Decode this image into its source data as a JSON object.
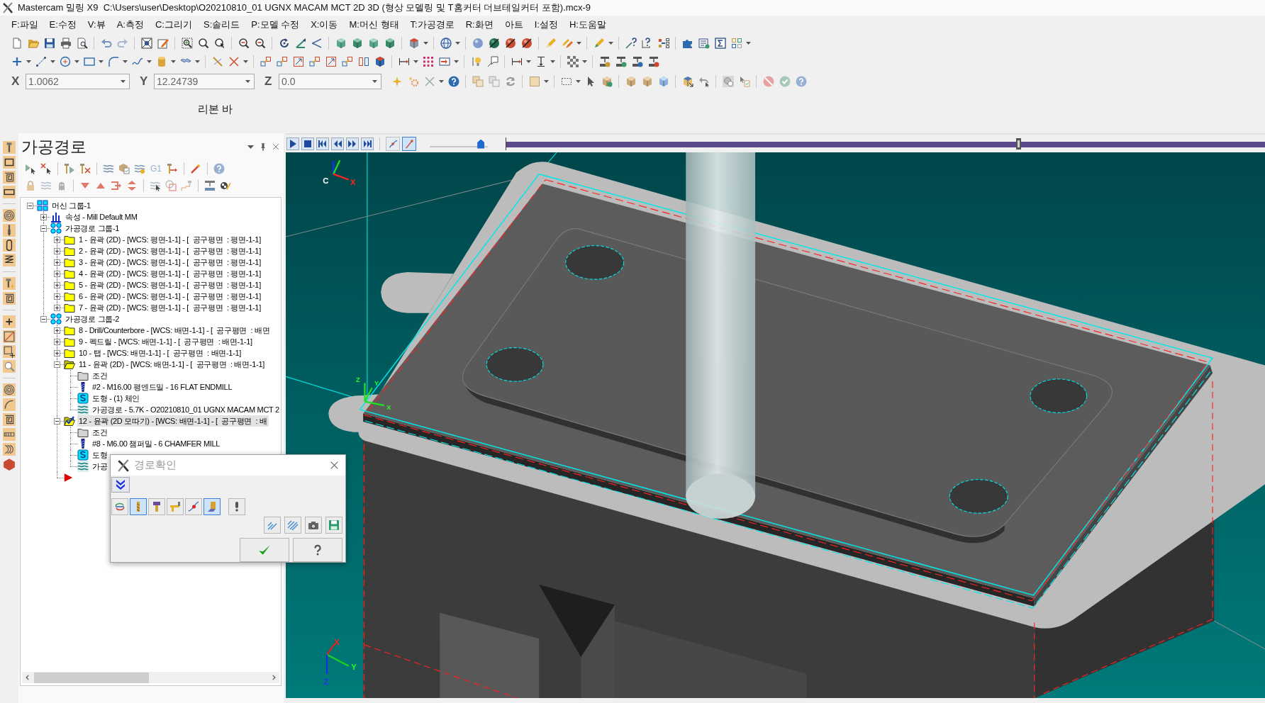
{
  "window": {
    "title": "Mastercam 밀링 X9  C:\\Users\\user\\Desktop\\O20210810_01 UGNX MACAM MCT 2D 3D (형상 모델링 및 T홈커터 더브테일커터 포함).mcx-9"
  },
  "menu": [
    "F:파일",
    "E:수정",
    "V:뷰",
    "A:측정",
    "C:그리기",
    "S:솔리드",
    "P:모델 수정",
    "X:이동",
    "M:머신 형태",
    "T:가공경로",
    "R:화면",
    "아트",
    "I:설정",
    "H:도움말"
  ],
  "coordinate_bar": [
    {
      "axis": "X",
      "value": "1.0062"
    },
    {
      "axis": "Y",
      "value": "12.24739"
    },
    {
      "axis": "Z",
      "value": "0.0"
    }
  ],
  "ribbon_bar": {
    "label": "리본 바"
  },
  "toolpaths_panel": {
    "title": "가공경로",
    "toolbar_text": "G1",
    "tree": [
      {
        "label": "머신 그룹-1",
        "kind": "machine_group",
        "expanded": true,
        "selected": false,
        "children": [
          {
            "label": "속성 - Mill Default MM",
            "kind": "properties",
            "expanded": false,
            "selected": false
          },
          {
            "label": "가공경로 그룹-1",
            "kind": "toolpath_group",
            "expanded": true,
            "selected": false,
            "children": [
              {
                "label": "1 - 윤곽 (2D) - [WCS: 평면-1-1] - [  공구평면  : 평면-1-1]",
                "kind": "operation",
                "expanded": false,
                "selected": false
              },
              {
                "label": "2 - 윤곽 (2D) - [WCS: 평면-1-1] - [  공구평면  : 평면-1-1]",
                "kind": "operation",
                "expanded": false,
                "selected": false
              },
              {
                "label": "3 - 윤곽 (2D) - [WCS: 평면-1-1] - [  공구평면  : 평면-1-1]",
                "kind": "operation",
                "expanded": false,
                "selected": false
              },
              {
                "label": "4 - 윤곽 (2D) - [WCS: 평면-1-1] - [  공구평면  : 평면-1-1]",
                "kind": "operation",
                "expanded": false,
                "selected": false
              },
              {
                "label": "5 - 윤곽 (2D) - [WCS: 평면-1-1] - [  공구평면  : 평면-1-1]",
                "kind": "operation",
                "expanded": false,
                "selected": false
              },
              {
                "label": "6 - 윤곽 (2D) - [WCS: 평면-1-1] - [  공구평면  : 평면-1-1]",
                "kind": "operation",
                "expanded": false,
                "selected": false
              },
              {
                "label": "7 - 윤곽 (2D) - [WCS: 평면-1-1] - [  공구평면  : 평면-1-1]",
                "kind": "operation",
                "expanded": false,
                "selected": false
              }
            ]
          },
          {
            "label": "가공경로 그룹-2",
            "kind": "toolpath_group",
            "expanded": true,
            "selected": false,
            "children": [
              {
                "label": "8 - Drill/Counterbore - [WCS: 배면-1-1] - [  공구평면  : 배면",
                "kind": "operation",
                "expanded": false,
                "selected": false
              },
              {
                "label": "9 - 펙드릴 - [WCS: 배면-1-1] - [  공구평면  : 배면-1-1]",
                "kind": "operation",
                "expanded": false,
                "selected": false
              },
              {
                "label": "10 - 탭 - [WCS: 배면-1-1] - [  공구평면  : 배면-1-1]",
                "kind": "operation",
                "expanded": false,
                "selected": false
              },
              {
                "label": "11 - 윤곽 (2D) - [WCS: 배면-1-1] - [  공구평면  : 배면-1-1]",
                "kind": "operation",
                "expanded": true,
                "selected": false,
                "children": [
                  {
                    "label": "조건",
                    "kind": "parameters",
                    "selected": false
                  },
                  {
                    "label": "#2 - M16.00 평엔드밀 - 16 FLAT ENDMILL",
                    "kind": "tool",
                    "selected": false
                  },
                  {
                    "label": "도형 - (1) 체인",
                    "kind": "geometry",
                    "selected": false
                  },
                  {
                    "label": "가공경로 - 5.7K - O20210810_01 UGNX MACAM MCT 2",
                    "kind": "toolpath",
                    "selected": false
                  }
                ]
              },
              {
                "label": "12 - 윤곽 (2D 모따기) - [WCS: 배면-1-1] - [  공구평면  : 배",
                "kind": "operation",
                "expanded": true,
                "selected": true,
                "children": [
                  {
                    "label": "조건",
                    "kind": "parameters",
                    "selected": false
                  },
                  {
                    "label": "#8 - M6.00 챔퍼밀 - 6 CHAMFER MILL",
                    "kind": "tool",
                    "selected": false
                  },
                  {
                    "label": "도형",
                    "kind": "geometry",
                    "selected": false
                  },
                  {
                    "label": "가공",
                    "kind": "toolpath",
                    "selected": false
                  }
                ]
              },
              {
                "kind": "insert_marker"
              }
            ]
          }
        ]
      }
    ]
  },
  "playback": {
    "display_toggles": [
      {
        "selected": false
      },
      {
        "selected": true
      }
    ],
    "speed": {
      "level": 0.88
    },
    "position": {
      "level": 0.675
    }
  },
  "viewport": {
    "axis_markers": [
      {
        "labels": [
          {
            "text": "C",
            "color": "#ffffff"
          },
          {
            "text": "X",
            "color": "#ff2020"
          }
        ]
      },
      {
        "labels": [
          {
            "text": "Z",
            "color": "#20ff20"
          },
          {
            "text": "Y",
            "color": "#20ff20"
          },
          {
            "text": "X",
            "color": "#20ff20"
          }
        ]
      },
      {
        "labels": [
          {
            "text": "X",
            "color": "#ff2020"
          },
          {
            "text": "Y",
            "color": "#20ff20"
          },
          {
            "text": "Z",
            "color": "#2030ff"
          }
        ]
      }
    ]
  },
  "verify_dialog": {
    "title": "경로확인",
    "toggles": [
      {
        "selected": false
      },
      {
        "selected": true
      },
      {
        "selected": false
      },
      {
        "selected": false
      },
      {
        "selected": false
      },
      {
        "selected": true
      },
      {
        "selected": false
      }
    ]
  }
}
